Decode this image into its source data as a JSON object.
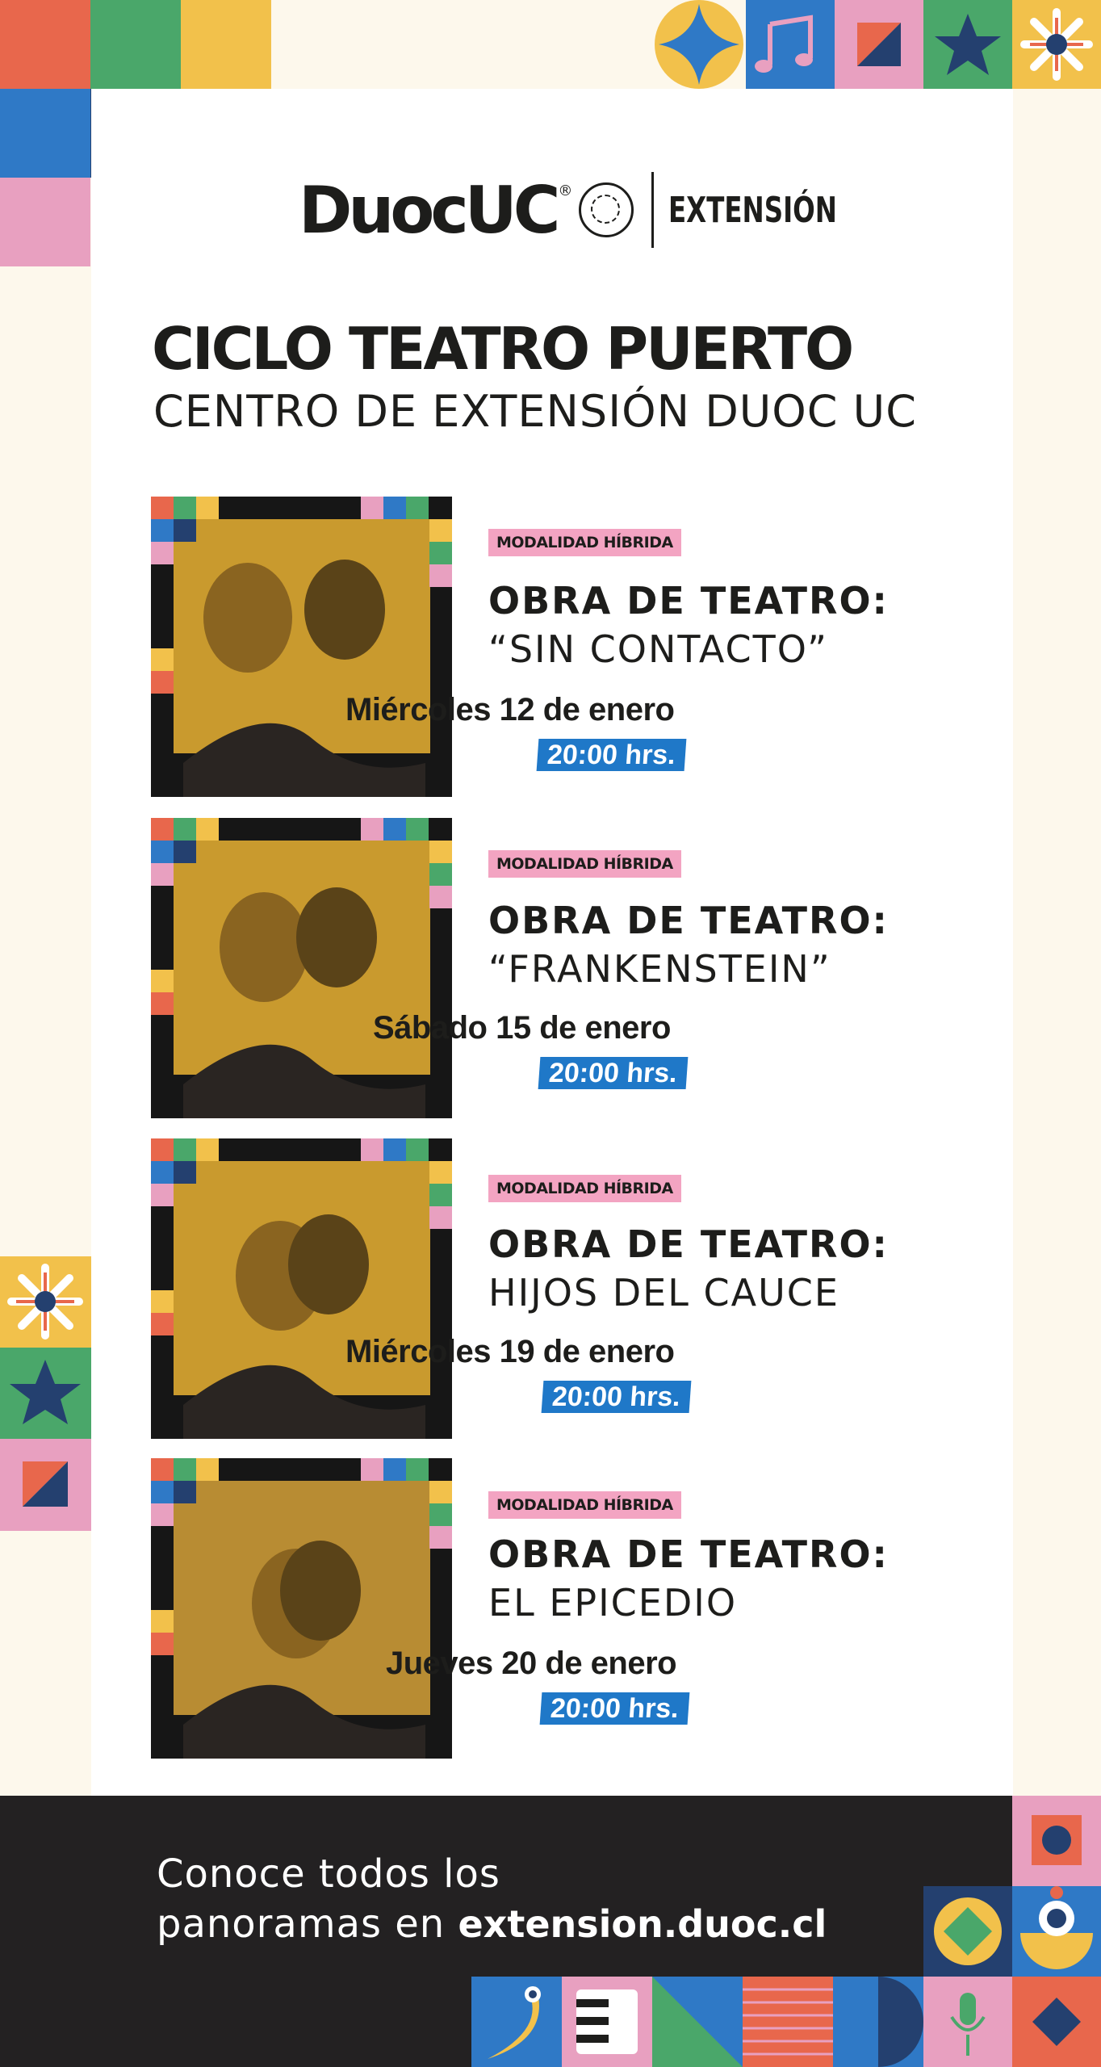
{
  "brand": {
    "logo_text": "DuocUC",
    "registered": "®",
    "division": "EXTENSIÓN"
  },
  "header": {
    "title": "CICLO TEATRO PUERTO",
    "subtitle": "CENTRO DE EXTENSIÓN DUOC UC"
  },
  "events": [
    {
      "badge": "MODALIDAD HÍBRIDA",
      "heading": "OBRA DE TEATRO:",
      "name": "“SIN CONTACTO”",
      "date": "Miércoles 12 de enero",
      "time": "20:00 hrs."
    },
    {
      "badge": "MODALIDAD HÍBRIDA",
      "heading": "OBRA DE TEATRO:",
      "name": "“FRANKENSTEIN”",
      "date": "Sábado 15 de enero",
      "time": "20:00 hrs."
    },
    {
      "badge": "MODALIDAD HÍBRIDA",
      "heading": "OBRA DE TEATRO:",
      "name": "HIJOS DEL CAUCE",
      "date": "Miércoles 19 de enero",
      "time": "20:00 hrs."
    },
    {
      "badge": "MODALIDAD HÍBRIDA",
      "heading": "OBRA DE TEATRO:",
      "name": "EL EPICEDIO",
      "date": "Jueves 20 de enero",
      "time": "20:00 hrs."
    }
  ],
  "footer": {
    "line1": "Conoce todos los",
    "line2_prefix": "panoramas en ",
    "link": "extension.duoc.cl"
  },
  "colors": {
    "orange": "#e8674c",
    "green": "#4aa76a",
    "yellow": "#f2c14b",
    "blue": "#2f79c6",
    "navy": "#24406f",
    "pink": "#e8a0c0",
    "badge_pink": "#f3a4c2",
    "time_blue": "#1f78c8",
    "dark": "#232122",
    "cream": "#fdf8ec"
  },
  "icons": [
    "diamond-star-icon",
    "music-note-icon",
    "triangle-split-icon",
    "star-icon",
    "flower-icon",
    "circle-icon",
    "microphone-icon",
    "piano-keys-icon"
  ]
}
